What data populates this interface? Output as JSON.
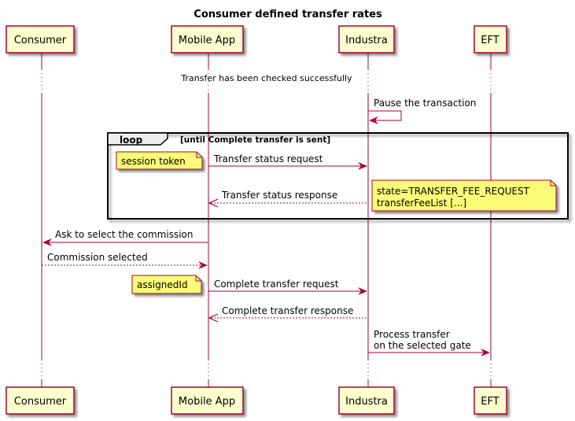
{
  "diagram": {
    "title": "Consumer defined transfer rates",
    "colors": {
      "line": "#A80036",
      "participant_fill": "#FEFECE",
      "note_fill": "#FBFB77",
      "loop_header_fill": "#EEEEEE",
      "text": "#000000"
    },
    "participants": [
      {
        "id": "consumer",
        "label": "Consumer"
      },
      {
        "id": "mobile",
        "label": "Mobile App"
      },
      {
        "id": "industra",
        "label": "Industra"
      },
      {
        "id": "eft",
        "label": "EFT"
      }
    ],
    "divider": {
      "label": "Transfer has been checked successfully"
    },
    "messages": [
      {
        "from": "industra",
        "to": "industra",
        "label": "Pause the transaction",
        "style": "solid"
      },
      {
        "from": "mobile",
        "to": "industra",
        "label": "Transfer status request",
        "style": "solid"
      },
      {
        "from": "industra",
        "to": "mobile",
        "label": "Transfer status response",
        "style": "dashed"
      },
      {
        "from": "mobile",
        "to": "consumer",
        "label": "Ask to select the commission",
        "style": "solid"
      },
      {
        "from": "consumer",
        "to": "mobile",
        "label": "Commission selected",
        "style": "dashed"
      },
      {
        "from": "mobile",
        "to": "industra",
        "label": "Complete transfer request",
        "style": "solid"
      },
      {
        "from": "industra",
        "to": "mobile",
        "label": "Complete transfer response",
        "style": "dashed"
      },
      {
        "from": "industra",
        "to": "eft",
        "label_lines": [
          "Process transfer",
          "on the selected gate"
        ],
        "style": "solid"
      }
    ],
    "loop": {
      "keyword": "loop",
      "condition": "[until Complete transfer is sent]"
    },
    "notes": [
      {
        "text_lines": [
          "session token"
        ]
      },
      {
        "text_lines": [
          "state=TRANSFER_FEE_REQUEST",
          "transferFeeList [...]"
        ]
      },
      {
        "text_lines": [
          "assignedId"
        ]
      }
    ]
  }
}
